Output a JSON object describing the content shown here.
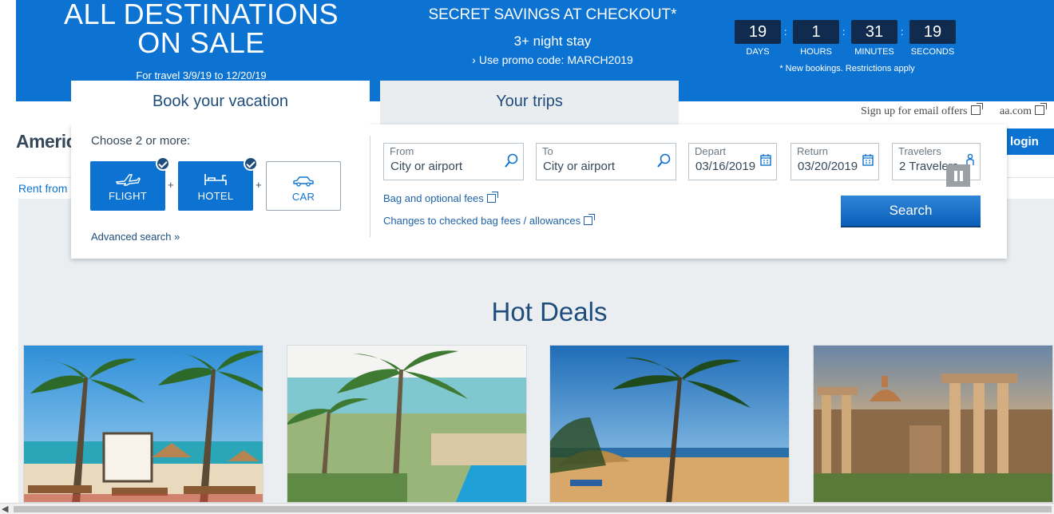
{
  "promo": {
    "headline": "ALL DESTINATIONS ON SALE",
    "travel_dates": "For travel 3/9/19 to 12/20/19",
    "secret": "SECRET SAVINGS AT CHECKOUT*",
    "stay": "3+ night stay",
    "promo_code": "Use promo code: MARCH2019",
    "note": "* New bookings. Restrictions apply",
    "countdown": [
      {
        "value": "19",
        "label": "DAYS"
      },
      {
        "value": "1",
        "label": "HOURS"
      },
      {
        "value": "31",
        "label": "MINUTES"
      },
      {
        "value": "19",
        "label": "SECONDS"
      }
    ],
    "separator": ":"
  },
  "header": {
    "email_offers": "Sign up for email offers",
    "aa_com": "aa.com",
    "brand_partial": "Americ",
    "login": "login",
    "rent_from": "Rent from"
  },
  "tabs": {
    "book": "Book your vacation",
    "trips": "Your trips"
  },
  "booking": {
    "choose": "Choose 2 or more:",
    "products": [
      {
        "label": "FLIGHT",
        "selected": true,
        "icon": "plane-icon"
      },
      {
        "label": "HOTEL",
        "selected": true,
        "icon": "bed-icon"
      },
      {
        "label": "CAR",
        "selected": false,
        "icon": "car-icon"
      }
    ],
    "plus": "+",
    "advanced": "Advanced search »",
    "from": {
      "label": "From",
      "value": "City or airport"
    },
    "to": {
      "label": "To",
      "value": "City or airport"
    },
    "depart": {
      "label": "Depart",
      "value": "03/16/2019"
    },
    "return": {
      "label": "Return",
      "value": "03/20/2019"
    },
    "travelers": {
      "label": "Travelers",
      "value": "2 Travelers"
    },
    "bag_fees": "Bag and optional fees",
    "checked_bag": "Changes to checked bag fees / allowances",
    "search": "Search"
  },
  "hot_deals": {
    "title": "Hot Deals",
    "images": [
      "beach-cabana-photo",
      "palm-resort-pool-photo",
      "palm-beach-sunset-photo",
      "rome-forum-photo"
    ]
  },
  "colors": {
    "brand_blue": "#0d73d2",
    "dark_navy": "#102b4d",
    "heading_blue": "#1e4d7b"
  }
}
